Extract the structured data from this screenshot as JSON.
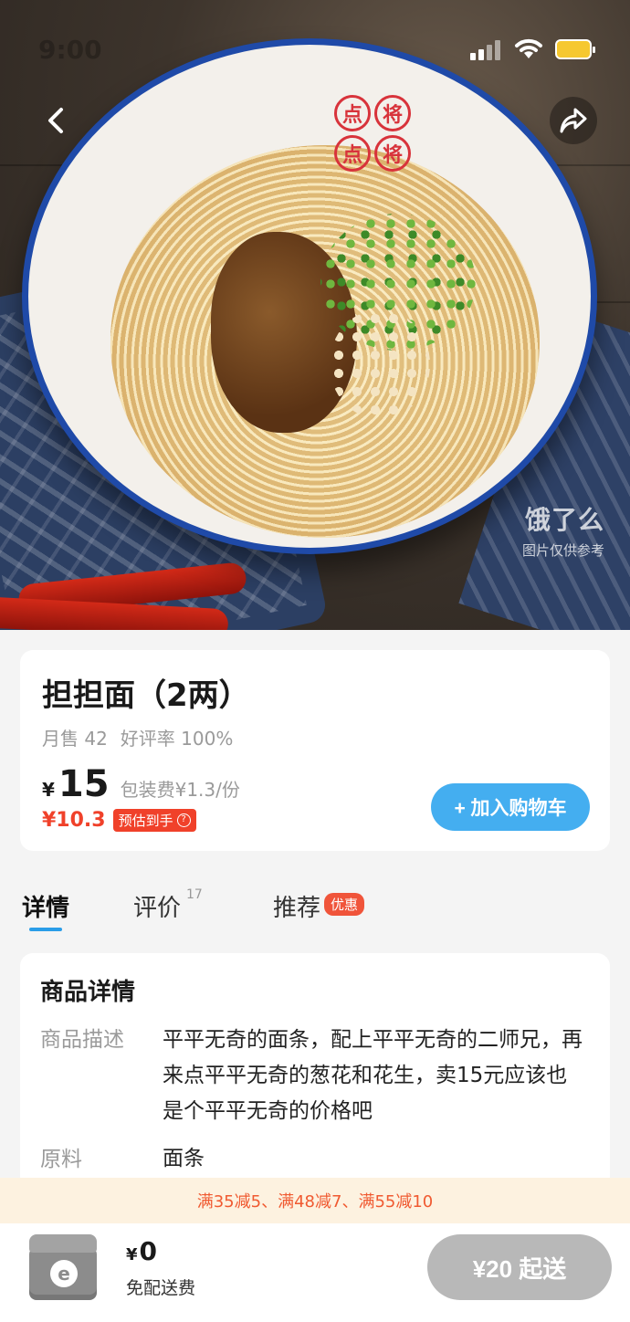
{
  "status_bar": {
    "time": "9:00"
  },
  "product": {
    "name": "担担面（2两）",
    "monthly_sales": "月售 42",
    "rating": "好评率 100%",
    "currency": "¥",
    "price": "15",
    "packaging_fee": "包装费¥1.3/份",
    "estimated_price": "¥10.3",
    "estimated_label": "预估到手",
    "add_to_cart_label": "+ 加入购物车",
    "seal_chars": [
      "点",
      "点",
      "点",
      "将"
    ]
  },
  "watermark": {
    "brand": "饿了么",
    "note": "图片仅供参考"
  },
  "tabs": [
    {
      "label": "详情"
    },
    {
      "label": "评价",
      "count": "17"
    },
    {
      "label": "推荐",
      "badge": "优惠"
    }
  ],
  "details": {
    "title": "商品详情",
    "description_label": "商品描述",
    "description": "平平无奇的面条，配上平平无奇的二师兄，再来点平平无奇的葱花和花生，卖15元应该也是个平平无奇的价格吧",
    "ingredients_label": "原料",
    "ingredients": "面条"
  },
  "promo": {
    "text": "满35减5、满48减7、满55减10"
  },
  "bottom_bar": {
    "currency": "¥",
    "total": "0",
    "delivery": "免配送费",
    "checkout_label": "¥20 起送"
  },
  "colors": {
    "accent_blue": "#44aef0",
    "price_red": "#f0412a",
    "promo_orange": "#f05a31",
    "promo_bg": "#fdf2e0",
    "disabled_gray": "#b8b8b8"
  }
}
